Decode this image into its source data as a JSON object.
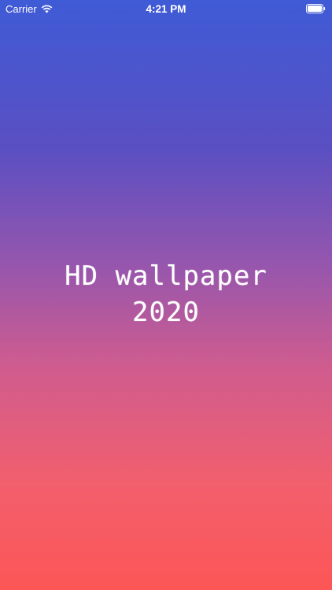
{
  "status_bar": {
    "carrier": "Carrier",
    "time": "4:21 PM",
    "wifi_icon": "wifi-icon",
    "battery_icon": "battery-icon"
  },
  "splash": {
    "title_line1": "HD wallpaper",
    "title_line2": "2020"
  },
  "colors": {
    "gradient_top": "#3f5bd6",
    "gradient_middle": "#9656ad",
    "gradient_bottom": "#fc5656",
    "text": "#ffffff"
  }
}
